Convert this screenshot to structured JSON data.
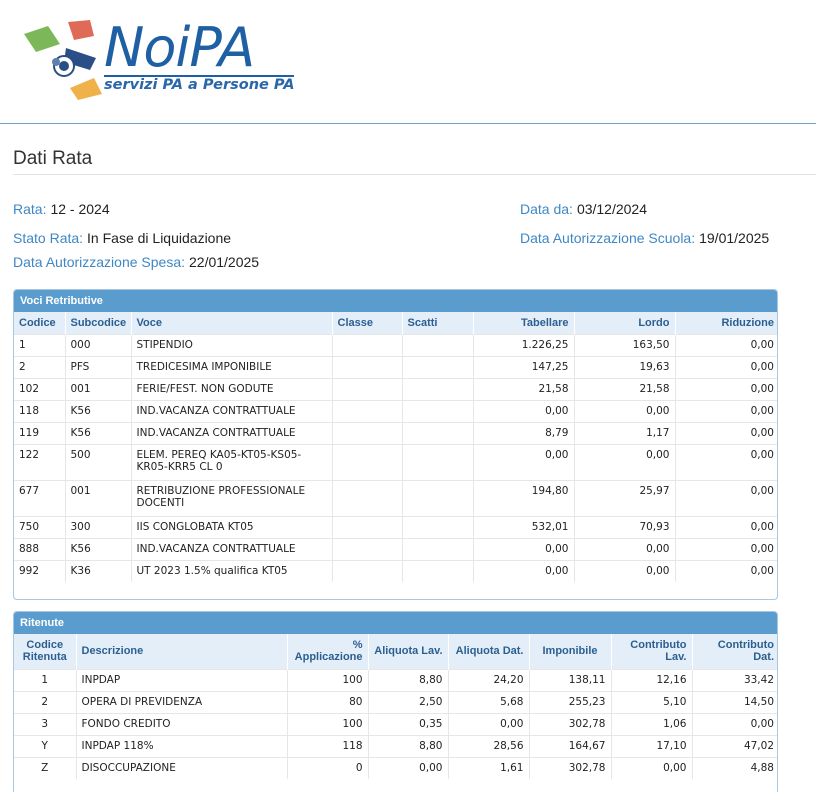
{
  "logo": {
    "word": "NoiPA",
    "tagline": "servizi PA a Persone PA"
  },
  "page_title": "Dati Rata",
  "info": {
    "rata_label": "Rata:",
    "rata_value": "12 - 2024",
    "data_da_label": "Data da:",
    "data_da_value": "03/12/2024",
    "stato_label": "Stato Rata:",
    "stato_value": "In Fase di Liquidazione",
    "aut_scuola_label": "Data Autorizzazione Scuola:",
    "aut_scuola_value": "19/01/2025",
    "aut_spesa_label": "Data Autorizzazione Spesa:",
    "aut_spesa_value": "22/01/2025"
  },
  "voci": {
    "title": "Voci Retributive",
    "headers": [
      "Codice",
      "Subcodice",
      "Voce",
      "Classe",
      "Scatti",
      "Tabellare",
      "Lordo",
      "Riduzione"
    ],
    "rows": [
      [
        "1",
        "000",
        "STIPENDIO",
        "",
        "",
        "1.226,25",
        "163,50",
        "0,00"
      ],
      [
        "2",
        "PFS",
        "TREDICESIMA IMPONIBILE",
        "",
        "",
        "147,25",
        "19,63",
        "0,00"
      ],
      [
        "102",
        "001",
        "FERIE/FEST. NON GODUTE",
        "",
        "",
        "21,58",
        "21,58",
        "0,00"
      ],
      [
        "118",
        "K56",
        "IND.VACANZA CONTRATTUALE",
        "",
        "",
        "0,00",
        "0,00",
        "0,00"
      ],
      [
        "119",
        "K56",
        "IND.VACANZA CONTRATTUALE",
        "",
        "",
        "8,79",
        "1,17",
        "0,00"
      ],
      [
        "122",
        "500",
        "ELEM. PEREQ KA05-KT05-KS05-KR05-KRR5 CL 0",
        "",
        "",
        "0,00",
        "0,00",
        "0,00"
      ],
      [
        "677",
        "001",
        "RETRIBUZIONE PROFESSIONALE DOCENTI",
        "",
        "",
        "194,80",
        "25,97",
        "0,00"
      ],
      [
        "750",
        "300",
        "IIS CONGLOBATA KT05",
        "",
        "",
        "532,01",
        "70,93",
        "0,00"
      ],
      [
        "888",
        "K56",
        "IND.VACANZA CONTRATTUALE",
        "",
        "",
        "0,00",
        "0,00",
        "0,00"
      ],
      [
        "992",
        "K36",
        "UT 2023 1.5% qualifica KT05",
        "",
        "",
        "0,00",
        "0,00",
        "0,00"
      ]
    ]
  },
  "ritenute": {
    "title": "Ritenute",
    "headers": [
      "Codice Ritenuta",
      "Descrizione",
      "% Applicazione",
      "Aliquota Lav.",
      "Aliquota Dat.",
      "Imponibile",
      "Contributo Lav.",
      "Contributo Dat."
    ],
    "rows": [
      [
        "1",
        "INPDAP",
        "100",
        "8,80",
        "24,20",
        "138,11",
        "12,16",
        "33,42"
      ],
      [
        "2",
        "OPERA DI PREVIDENZA",
        "80",
        "2,50",
        "5,68",
        "255,23",
        "5,10",
        "14,50"
      ],
      [
        "3",
        "FONDO CREDITO",
        "100",
        "0,35",
        "0,00",
        "302,78",
        "1,06",
        "0,00"
      ],
      [
        "Y",
        "INPDAP 118%",
        "118",
        "8,80",
        "28,56",
        "164,67",
        "17,10",
        "47,02"
      ],
      [
        "Z",
        "DISOCCUPAZIONE",
        "0",
        "0,00",
        "1,61",
        "302,78",
        "0,00",
        "4,88"
      ]
    ]
  }
}
